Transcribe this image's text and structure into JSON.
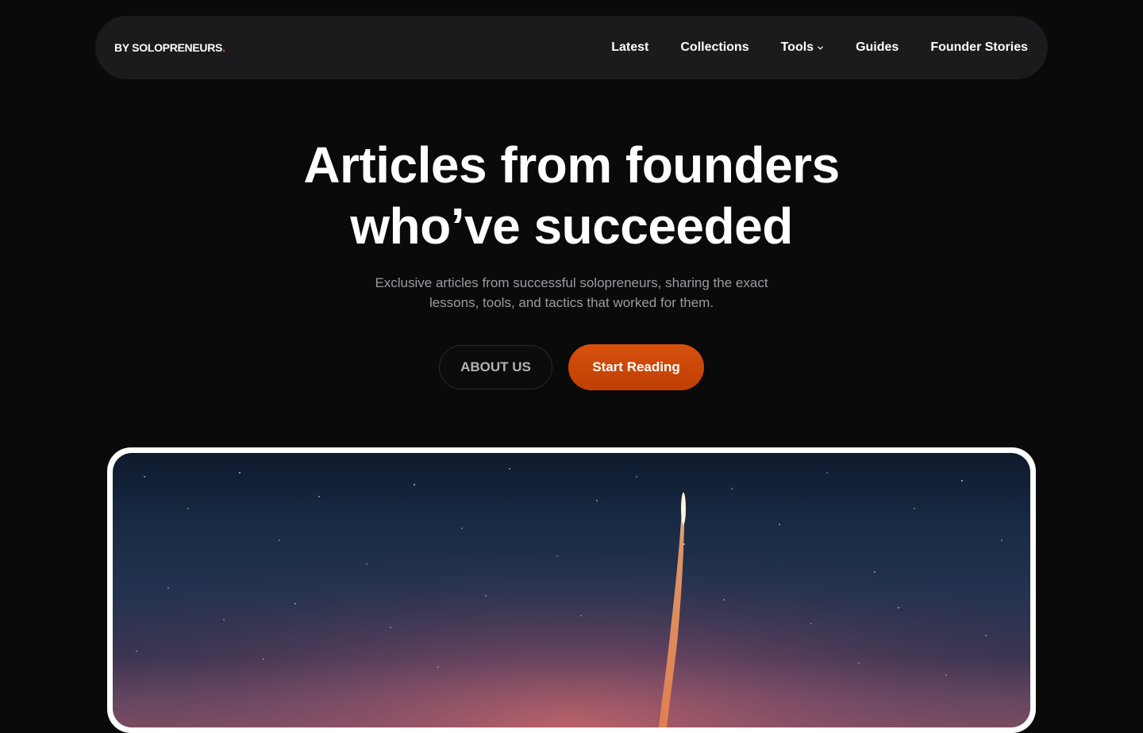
{
  "brand": {
    "logo_text": "BY SOLOPRENEURS",
    "logo_dot": ".",
    "accent_color": "#e0551a"
  },
  "nav": {
    "items": [
      {
        "label": "Latest"
      },
      {
        "label": "Collections"
      },
      {
        "label": "Tools",
        "icon": "chevron-down-icon"
      },
      {
        "label": "Guides"
      },
      {
        "label": "Founder Stories"
      }
    ]
  },
  "hero": {
    "title_line1": "Articles from founders",
    "title_line2": "who’ve succeeded",
    "subtitle_line1": "Exclusive articles from successful solopreneurs, sharing the exact",
    "subtitle_line2": "lessons, tools, and tactics that worked for them.",
    "secondary_button": "ABOUT US",
    "primary_button": "Start Reading",
    "primary_color": "#d14a0a"
  }
}
